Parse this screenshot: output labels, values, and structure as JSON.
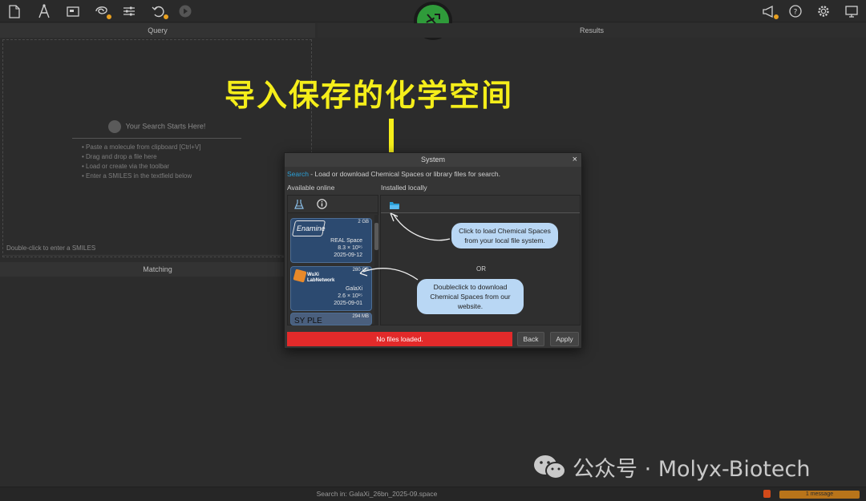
{
  "toolbar": {
    "left_icons": [
      "new-file-icon",
      "draw-icon",
      "console-icon",
      "spaces-icon",
      "filter-icon",
      "history-icon",
      "run-icon"
    ],
    "right_icons": [
      "announce-icon",
      "help-icon",
      "settings-icon",
      "screen-icon"
    ]
  },
  "panels": {
    "query_title": "Query",
    "results_title": "Results",
    "matching_title": "Matching"
  },
  "query": {
    "start_title": "Your Search Starts Here!",
    "tips": [
      "Paste a molecule from clipboard [Ctrl+V]",
      "Drag and drop a file here",
      "Load or create via the toolbar",
      "Enter a SMILES in the textfield below"
    ],
    "smiles_hint": "Double-click to enter a SMILES"
  },
  "annotation": {
    "title": "导入保存的化学空间"
  },
  "dialog": {
    "title": "System",
    "close": "×",
    "desc_accent": "Search",
    "desc_rest": " - Load or download Chemical Spaces or library files for search.",
    "available_label": "Available online",
    "installed_label": "Installed locally",
    "cards": [
      {
        "size": "2 GB",
        "logo": "Enamine",
        "name": "REAL Space",
        "count": "8.3 × 10¹⁵",
        "date": "2025-09-12"
      },
      {
        "size": "280 GB",
        "logo": "WuXi LabNetwork",
        "name": "GalaXi",
        "count": "2.6 × 10¹⁵",
        "date": "2025-09-01"
      },
      {
        "size": "294 MB",
        "logo": "SY PLE",
        "name": "",
        "count": "",
        "date": ""
      }
    ],
    "bubble_load": "Click to load Chemical Spaces from your local file system.",
    "or": "OR",
    "bubble_download": "Doubleclick to download Chemical Spaces from our website.",
    "status": "No files loaded.",
    "back": "Back",
    "apply": "Apply"
  },
  "bottom": {
    "search_in": "Search in: GalaXi_26bn_2025-09.space",
    "message": "1 message"
  },
  "watermark": {
    "text": "公众号 · Molyx-Biotech"
  },
  "colors": {
    "accent": "#2a9fd6",
    "status_error": "#e22a2a",
    "logo_green": "#2f9b3a",
    "annotation_yellow": "#f5ee1a"
  }
}
